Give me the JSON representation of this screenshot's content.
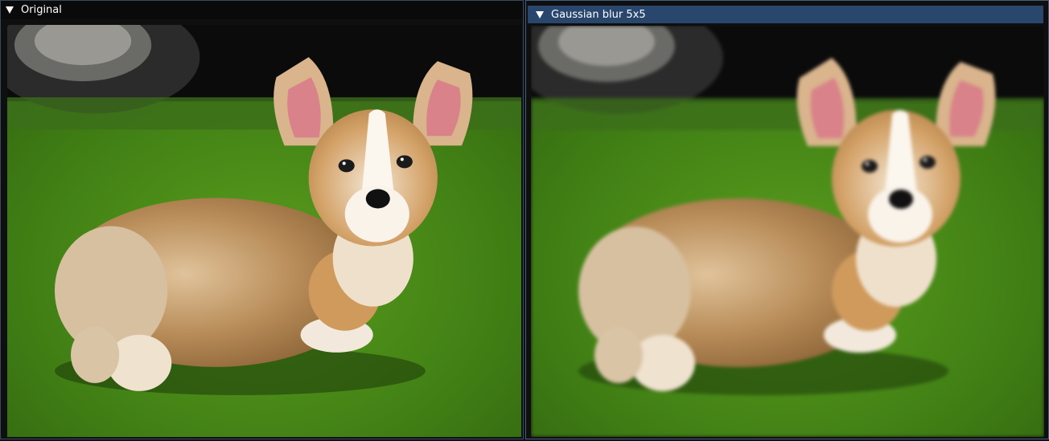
{
  "windows": [
    {
      "title": "Original",
      "image": "photo of a corgi puppy standing on grass"
    },
    {
      "title": "Gaussian blur 5x5",
      "image": "gaussian-blurred photo of a corgi puppy standing on grass"
    }
  ],
  "colors": {
    "title_active_bg": "#29466d",
    "title_inactive_bg": "#0a0a0a",
    "window_border": "#3a4a5e",
    "grass": "#4f8f1c",
    "fur": "#c79a62"
  }
}
